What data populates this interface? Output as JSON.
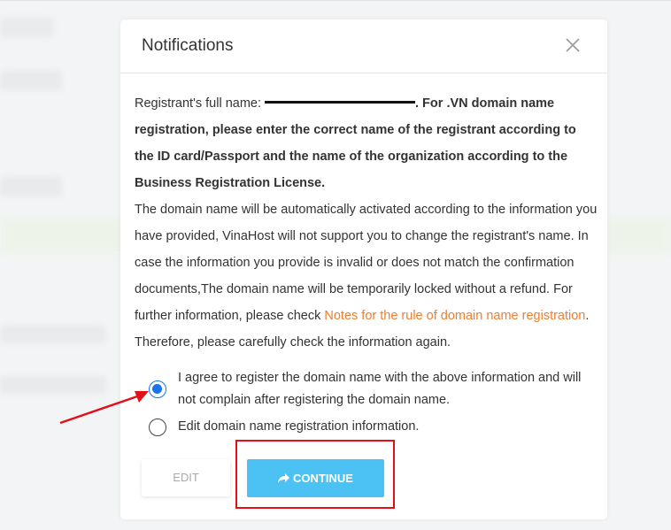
{
  "modal": {
    "title": "Notifications",
    "close_icon": "close-icon",
    "text": {
      "label": "Registrant's full name:",
      "bold": ". For .VN domain name registration, please enter the correct name of the registrant according to the ID card/Passport and the name of the organization according to the Business Registration License.",
      "para": "The domain name will be automatically activated according to the information you have provided, VinaHost will not support you to change the registrant's name. In case the information you provide is invalid or does not match the confirmation documents,The domain name will be temporarily locked without a refund. For further information, please check",
      "link": "Notes for the rule of domain name registration",
      "tail": ". Therefore, please carefully check the information again."
    },
    "options": {
      "agree": "I agree to register the domain name with the above information and will not complain after registering the domain name.",
      "edit": "Edit domain name registration information."
    },
    "buttons": {
      "edit": "EDIT",
      "continue": "CONTINUE",
      "continue_icon": "share-arrow-icon"
    }
  },
  "colors": {
    "link": "#ee7d2f",
    "continue_bg": "#4cc2f4",
    "radio_selected": "#1a73e8",
    "annotation": "#e3101a"
  }
}
